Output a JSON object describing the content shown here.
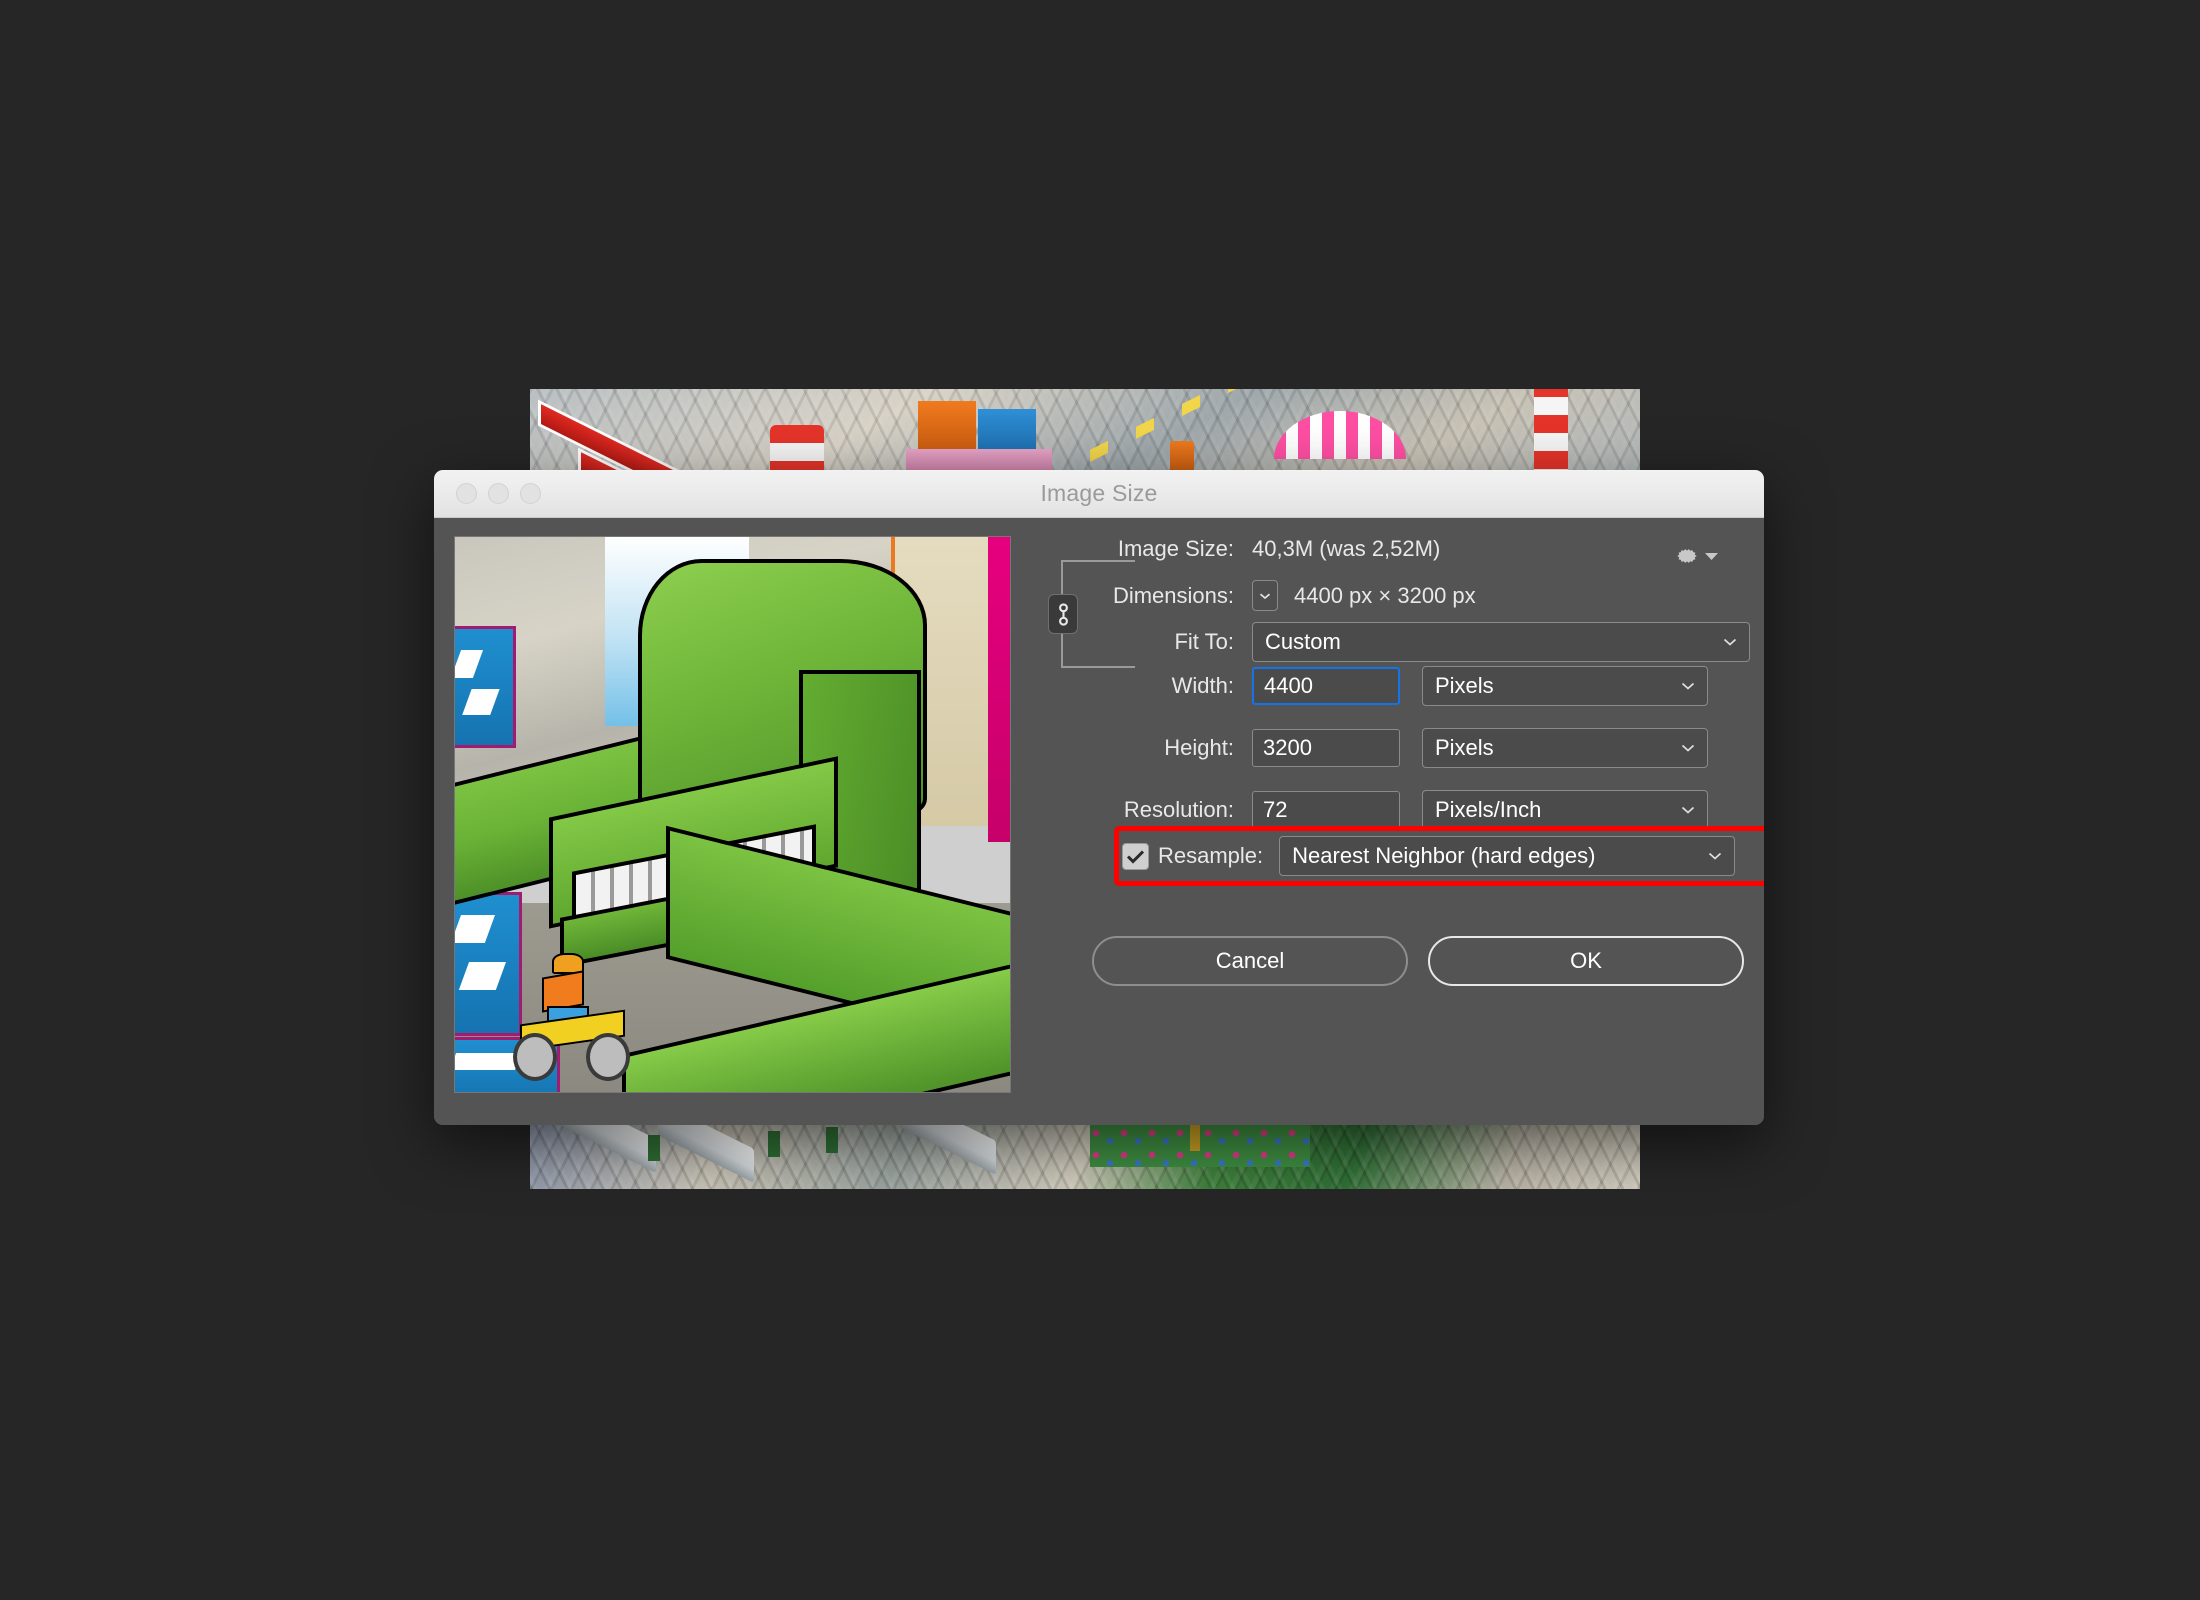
{
  "window": {
    "title": "Image Size",
    "traffic_lights": [
      "close",
      "minimize",
      "zoom"
    ]
  },
  "preview": {
    "alt": "isometric pixel-art preview of a large green creature in a city street with a cyclist"
  },
  "info": {
    "image_size_label": "Image Size:",
    "image_size_value": "40,3M (was 2,52M)",
    "dimensions_label": "Dimensions:",
    "dimensions_value": "4400 px  ×  3200 px",
    "gear_icon": "gear-icon"
  },
  "fields": {
    "fit_to_label": "Fit To:",
    "fit_to_value": "Custom",
    "width_label": "Width:",
    "width_value": "4400",
    "width_unit": "Pixels",
    "height_label": "Height:",
    "height_value": "3200",
    "height_unit": "Pixels",
    "resolution_label": "Resolution:",
    "resolution_value": "72",
    "resolution_unit": "Pixels/Inch",
    "resample_label": "Resample:",
    "resample_value": "Nearest Neighbor (hard edges)",
    "resample_checked": true,
    "constrain_icon": "chain-link-icon"
  },
  "buttons": {
    "cancel": "Cancel",
    "ok": "OK"
  },
  "colors": {
    "page_background": "#262626",
    "dialog_background": "#545454",
    "titlebar": "#eeeeee",
    "field_background": "#4b4b4b",
    "field_border": "#8a8a8a",
    "focus_blue": "#1473e6",
    "highlight_red": "#ff0000",
    "text": "#e8e8e8"
  }
}
